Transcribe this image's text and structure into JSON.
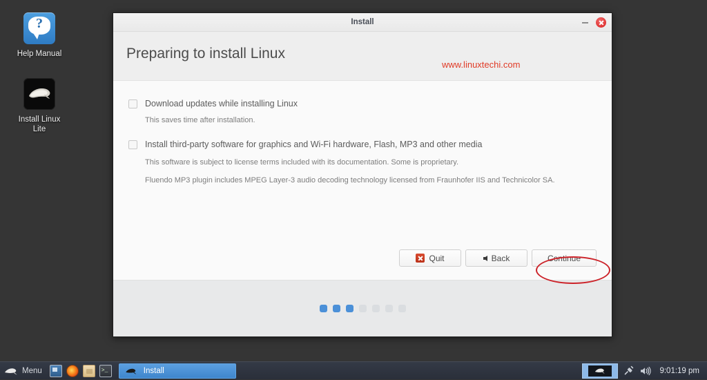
{
  "desktop": {
    "icons": [
      {
        "name": "help-manual",
        "label": "Help Manual",
        "icon": "help-question-icon"
      },
      {
        "name": "install-linux-lite",
        "label_line1": "Install Linux",
        "label_line2": "Lite",
        "icon": "linux-lite-swoosh-icon"
      }
    ]
  },
  "window": {
    "title": "Install",
    "minimize_label": "",
    "close_label": "",
    "heading": "Preparing to install Linux",
    "watermark": "www.linuxtechi.com"
  },
  "options": [
    {
      "label": "Download updates while installing Linux",
      "checked": false,
      "notes": [
        "This saves time after installation."
      ]
    },
    {
      "label": "Install third-party software for graphics and Wi-Fi hardware, Flash, MP3 and other media",
      "checked": false,
      "notes": [
        "This software is subject to license terms included with its documentation. Some is proprietary.",
        "Fluendo MP3 plugin includes MPEG Layer-3 audio decoding technology licensed from Fraunhofer IIS and Technicolor SA."
      ]
    }
  ],
  "buttons": {
    "quit": "Quit",
    "back": "Back",
    "continue": "Continue"
  },
  "progress": {
    "total_steps": 7,
    "active_steps": 3,
    "active_color": "#4b90d8",
    "inactive_color": "#dadde0"
  },
  "annotation": {
    "type": "ellipse-highlight",
    "target": "Continue",
    "color": "#cc2229"
  },
  "taskbar": {
    "menu_label": "Menu",
    "launchers": [
      {
        "name": "display-settings",
        "icon": "monitor-icon"
      },
      {
        "name": "firefox",
        "icon": "firefox-icon"
      },
      {
        "name": "file-manager",
        "icon": "folder-icon"
      },
      {
        "name": "terminal",
        "icon": "terminal-icon",
        "glyph": ">_"
      }
    ],
    "tasks": [
      {
        "label": "Install",
        "active": true,
        "icon": "linux-lite-swoosh-icon"
      }
    ],
    "tray": {
      "workspace_icon": "workspace-switcher-icon",
      "plug_icon": "plug-icon",
      "volume_icon": "speaker-icon",
      "clock": "9:01:19 pm"
    }
  },
  "colors": {
    "desktop_bg": "#353535",
    "taskbar_bg": "#2a2f3a",
    "accent_blue": "#4b90d8",
    "watermark_red": "#e03a26",
    "annotation_red": "#cc2229"
  }
}
